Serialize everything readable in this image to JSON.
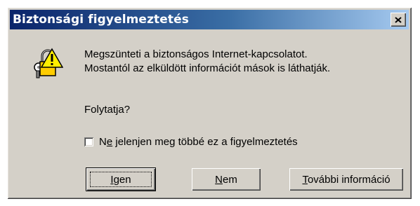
{
  "window": {
    "title": "Biztonsági figyelmeztetés",
    "close_glyph": "close-icon"
  },
  "icon": {
    "name": "security-warning-icon",
    "colors": {
      "padlock": "#ffcc00",
      "outline": "#000000",
      "key": "#808080"
    }
  },
  "message": {
    "line1": "Megszünteti a biztonságos Internet-kapcsolatot.",
    "line2": "Mostantól az elküldött információt mások is láthatják."
  },
  "question": "Folytatja?",
  "checkbox": {
    "checked": false,
    "label_pre": "N",
    "label_access": "e",
    "label_post": " jelenjen meg többé ez a figyelmeztetés"
  },
  "buttons": {
    "yes": {
      "access": "I",
      "rest": "gen"
    },
    "no": {
      "access": "N",
      "rest": "em"
    },
    "more": {
      "access": "T",
      "rest": "ovábbi információ"
    }
  },
  "colors": {
    "face": "#d4d0c8",
    "title_start": "#0a246a",
    "title_end": "#a6caf0",
    "title_text": "#ffffff"
  }
}
